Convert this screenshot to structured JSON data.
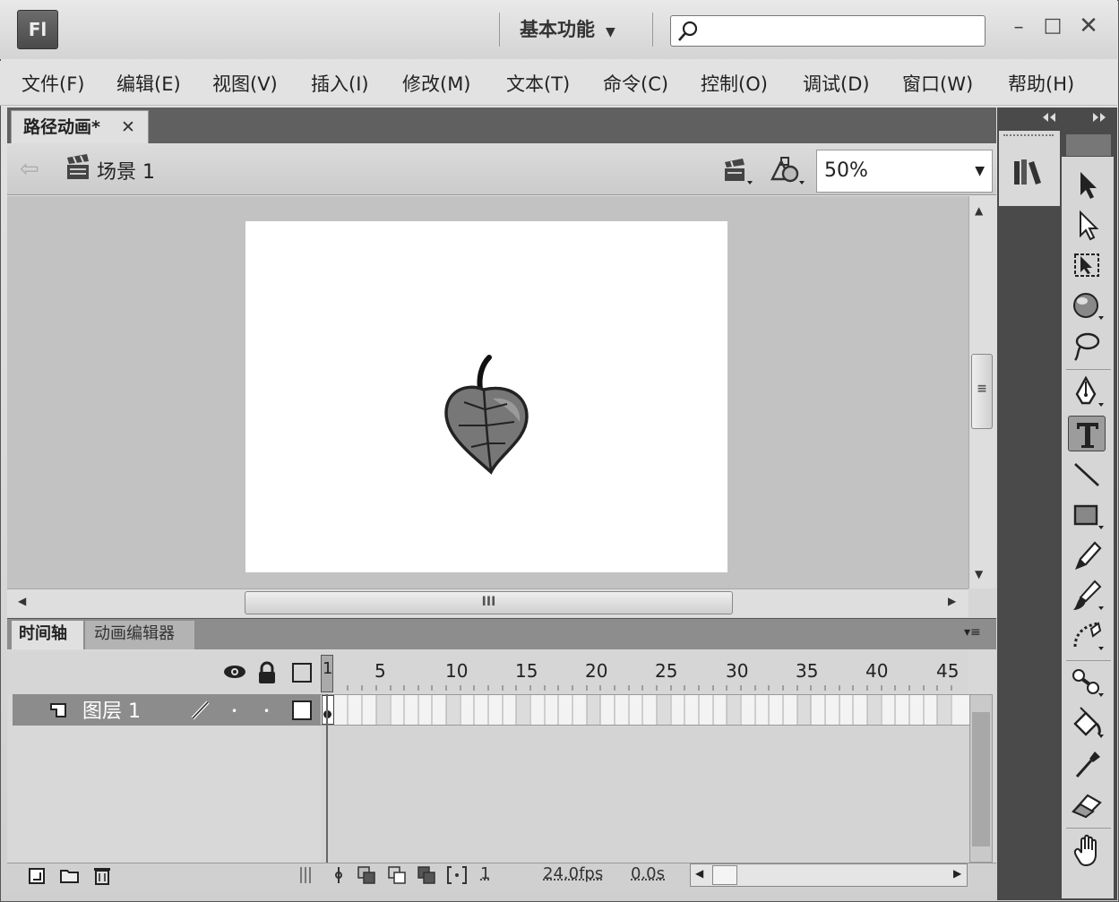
{
  "app": {
    "logo": "Fl",
    "workspace": "基本功能",
    "workspace_arrow": "▼",
    "search": {
      "placeholder": ""
    }
  },
  "window_controls": {
    "minimize": "–",
    "maximize": "□",
    "close": "✕"
  },
  "menu": [
    "文件(F)",
    "编辑(E)",
    "视图(V)",
    "插入(I)",
    "修改(M)",
    "文本(T)",
    "命令(C)",
    "控制(O)",
    "调试(D)",
    "窗口(W)",
    "帮助(H)"
  ],
  "document": {
    "tab": "路径动画*",
    "close": "✕"
  },
  "editbar": {
    "back": "⇦",
    "scene": "场景 1",
    "zoom": "50%",
    "zoom_arrow": "▼"
  },
  "scroll": {
    "up": "▲",
    "down": "▼",
    "left": "◀",
    "right": "▶",
    "grip_v": "≡",
    "grip_h": "III"
  },
  "panel": {
    "tabs": [
      "时间轴",
      "动画编辑器"
    ],
    "menu": "▾≡"
  },
  "timeline": {
    "ruler": [
      "5",
      "10",
      "15",
      "20",
      "25",
      "30",
      "35",
      "40",
      "45"
    ],
    "current_frame_marker": "1",
    "layer": {
      "name": "图层 1",
      "dot": "•"
    },
    "status": {
      "frame": "1",
      "fps": "24.0fps",
      "time": "0.0s"
    }
  },
  "icons": {
    "search": "search-icon",
    "scene": "clapboard-icon",
    "edit_symbols": "edit-symbols-icon",
    "edit_scene": "edit-scene-icon",
    "library": "library-icon"
  },
  "tools": [
    "selection-tool",
    "subselection-tool",
    "free-transform-tool",
    "3d-rotation-tool",
    "lasso-tool",
    "pen-tool",
    "text-tool",
    "line-tool",
    "rectangle-tool",
    "pencil-tool",
    "brush-tool",
    "deco-tool",
    "bone-tool",
    "paint-bucket-tool",
    "eyedropper-tool",
    "eraser-tool",
    "hand-tool"
  ],
  "colors": {
    "chrome": "#d6d6d6",
    "dark_panel": "#4a4a4a",
    "stage": "#ffffff",
    "pasteboard": "#c2c2c2"
  }
}
